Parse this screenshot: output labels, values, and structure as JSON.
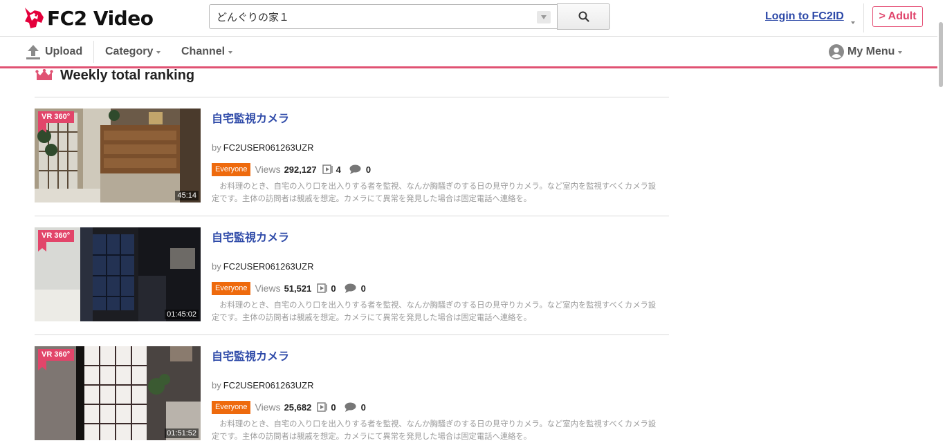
{
  "header": {
    "logo_text": "FC2 Video",
    "search": {
      "value": "どんぐりの家１",
      "placeholder": ""
    },
    "login_label": "Login to FC2ID",
    "adult_label": "> Adult"
  },
  "nav": {
    "upload_label": "Upload",
    "category_label": "Category",
    "channel_label": "Channel",
    "my_menu_label": "My Menu"
  },
  "ranking": {
    "title": "Weekly total ranking",
    "videos": [
      {
        "title": "自宅監視カメラ",
        "by_label": "by",
        "user": "FC2USER061263UZR",
        "badge": "VR 360°",
        "duration": "45:14",
        "rating": "Everyone",
        "views_label": "Views",
        "views": "292,127",
        "playlists": "4",
        "comments": "0",
        "description": "お料理のとき、自宅の入り口を出入りする者を監視、なんか胸騒ぎのする日の見守りカメラ。など室内を監視すべくカメラ設定です。主体の訪問者は親戚を想定。カメラにて異常を発見した場合は固定電話へ連絡を。"
      },
      {
        "title": "自宅監視カメラ",
        "by_label": "by",
        "user": "FC2USER061263UZR",
        "badge": "VR 360°",
        "duration": "01:45:02",
        "rating": "Everyone",
        "views_label": "Views",
        "views": "51,521",
        "playlists": "0",
        "comments": "0",
        "description": "お料理のとき、自宅の入り口を出入りする者を監視、なんか胸騒ぎのする日の見守りカメラ。など室内を監視すべくカメラ設定です。主体の訪問者は親戚を想定。カメラにて異常を発見した場合は固定電話へ連絡を。"
      },
      {
        "title": "自宅監視カメラ",
        "by_label": "by",
        "user": "FC2USER061263UZR",
        "badge": "VR 360°",
        "duration": "01:51:52",
        "rating": "Everyone",
        "views_label": "Views",
        "views": "25,682",
        "playlists": "0",
        "comments": "0",
        "description": "お料理のとき、自宅の入り口を出入りする者を監視、なんか胸騒ぎのする日の見守りカメラ。など室内を監視すべくカメラ設定です。主体の訪問者は親戚を想定。カメラにて異常を発見した場合は固定電話へ連絡を。"
      }
    ]
  },
  "icons": {
    "logo": "fc2-unicorn-logo",
    "search": "search-icon",
    "upload": "upload-icon",
    "my_menu": "user-avatar-icon",
    "ranking": "crown-icon",
    "playlist": "playlist-icon",
    "comment": "comment-icon"
  },
  "colors": {
    "accent_red": "#e05273",
    "link_blue": "#2d49a8",
    "rating_orange": "#ee6a0d"
  }
}
